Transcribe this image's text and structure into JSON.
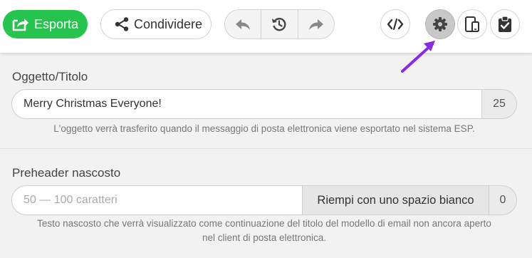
{
  "toolbar": {
    "export_label": "Esporta",
    "share_label": "Condividere",
    "accent_color": "#27c34f",
    "icons": [
      "export-icon",
      "share-icon",
      "undo-icon",
      "history-icon",
      "redo-icon",
      "code-icon",
      "gear-icon",
      "responsive-devices-icon",
      "clipboard-check-icon"
    ]
  },
  "subject": {
    "label": "Oggetto/Titolo",
    "value": "Merry Christmas Everyone!",
    "count": "25",
    "hint": "L'oggetto verrà trasferito quando il messaggio di posta elettronica viene esportato nel sistema ESP."
  },
  "preheader": {
    "label": "Preheader nascosto",
    "placeholder": "50 — 100 caratteri",
    "fill_button": "Riempi con uno spazio bianco",
    "count": "0",
    "hint_line1": "Testo nascosto che verrà visualizzato come continuazione del titolo del modello di email non ancora aperto",
    "hint_line2": "nel client di posta elettronica."
  }
}
